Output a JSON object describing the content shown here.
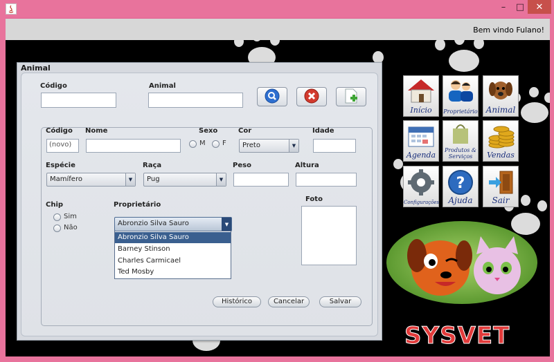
{
  "header": {
    "welcome": "Bem vindo Fulano!"
  },
  "window_controls": {
    "minimize": "–",
    "maximize": "□",
    "close": "✕"
  },
  "animal_form": {
    "title": "Animal",
    "search": {
      "codigo_label": "Código",
      "codigo_value": "",
      "animal_label": "Animal",
      "animal_value": ""
    },
    "actions": {
      "search_icon": "magnifier-icon",
      "delete_icon": "delete-x-icon",
      "new_icon": "new-document-icon"
    },
    "fields": {
      "codigo_label": "Código",
      "codigo_value": "(novo)",
      "nome_label": "Nome",
      "nome_value": "",
      "sexo_label": "Sexo",
      "sexo_m": "M",
      "sexo_f": "F",
      "cor_label": "Cor",
      "cor_value": "Preto",
      "idade_label": "Idade",
      "idade_value": "",
      "especie_label": "Espécie",
      "especie_value": "Mamífero",
      "raca_label": "Raça",
      "raca_value": "Pug",
      "peso_label": "Peso",
      "peso_value": "",
      "altura_label": "Altura",
      "altura_value": "",
      "chip_label": "Chip",
      "chip_sim": "Sim",
      "chip_nao": "Não",
      "proprietario_label": "Proprietário",
      "proprietario_value": "Abronzio Silva Sauro",
      "foto_label": "Foto"
    },
    "proprietario_options": [
      "Abronzio Silva Sauro",
      "Barney Stinson",
      "Charles Carmicael",
      "Ted Mosby"
    ],
    "buttons": {
      "historico": "Histórico",
      "cancelar": "Cancelar",
      "salvar": "Salvar"
    }
  },
  "menu": [
    {
      "label": "Início",
      "icon": "house-icon"
    },
    {
      "label": "Proprietário",
      "icon": "people-icon"
    },
    {
      "label": "Animal",
      "icon": "dog-icon"
    },
    {
      "label": "Agenda",
      "icon": "calendar-icon"
    },
    {
      "label": "Produtos & Serviços",
      "icon": "shopping-bag-icon"
    },
    {
      "label": "Vendas",
      "icon": "coins-icon"
    },
    {
      "label": "Configurações",
      "icon": "gear-icon"
    },
    {
      "label": "Ajuda",
      "icon": "help-icon"
    },
    {
      "label": "Sair",
      "icon": "exit-door-icon"
    }
  ],
  "logo": {
    "text": "SYSVET"
  },
  "colors": {
    "accent_blue": "#3a5f8f",
    "window_frame": "#e8739c",
    "close_red": "#c7504b"
  }
}
